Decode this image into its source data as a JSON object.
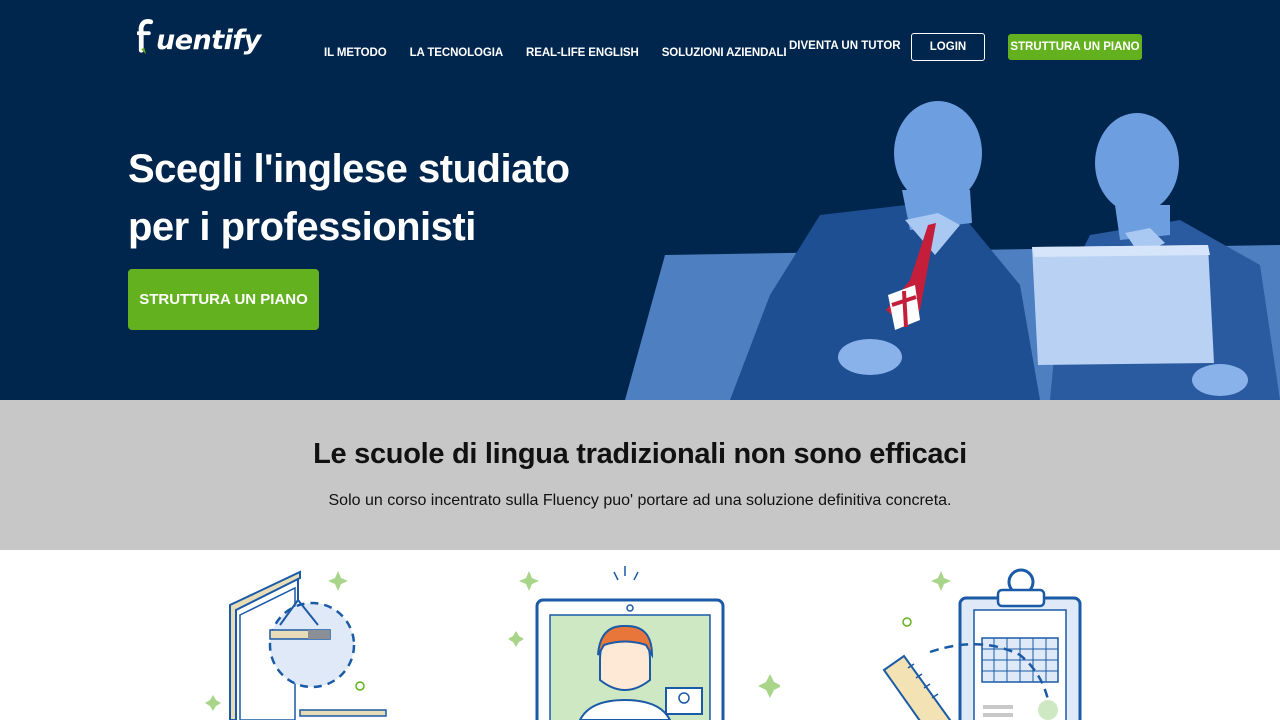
{
  "brand": {
    "name": "fluentify",
    "logo_text": "uentify"
  },
  "nav": {
    "items": [
      "IL METODO",
      "LA TECNOLOGIA",
      "REAL-LIFE ENGLISH",
      "SOLUZIONI AZIENDALI"
    ],
    "tutor_link": "DIVENTA UN TUTOR",
    "login": "LOGIN",
    "cta": "STRUTTURA UN PIANO"
  },
  "hero": {
    "title_line1": "Scegli l'inglese studiato",
    "title_line2": "per i professionisti",
    "cta": "STRUTTURA UN PIANO"
  },
  "section": {
    "heading": "Le scuole di lingua tradizionali non sono efficaci",
    "subtext": "Solo un corso incentrato sulla Fluency puo' portare ad una soluzione definitiva concreta."
  },
  "colors": {
    "hero_bg": "#00264d",
    "accent_green": "#63b11f",
    "band_bg": "#c7c7c7",
    "illus_blue": "#1a5aa6"
  },
  "icons": [
    "head-scale-illustration",
    "video-call-illustration",
    "clipboard-plan-illustration"
  ]
}
